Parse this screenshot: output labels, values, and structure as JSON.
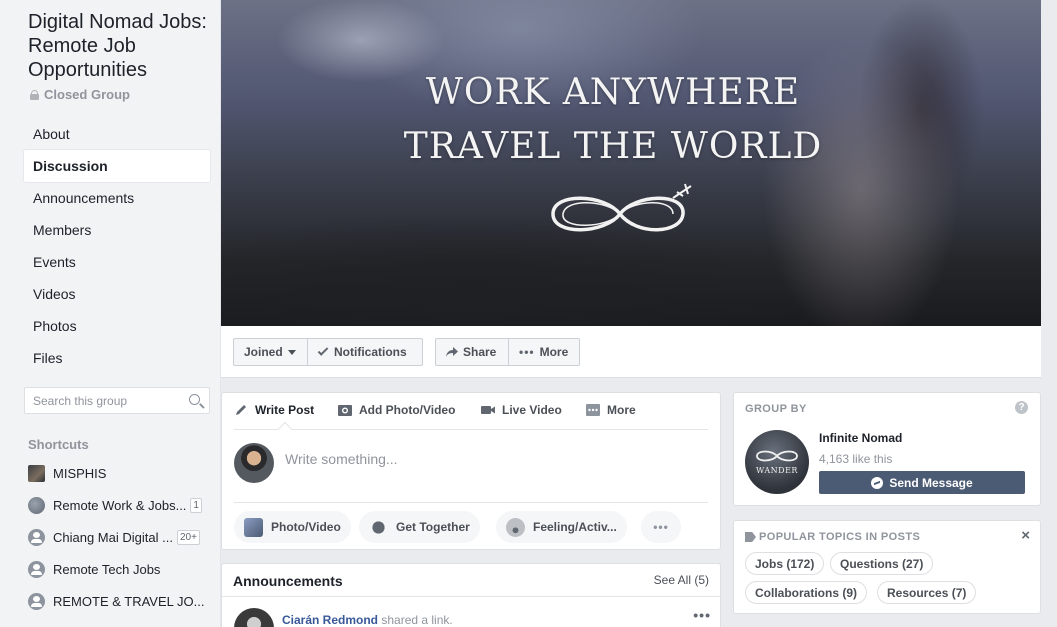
{
  "group": {
    "title": "Digital Nomad Jobs: Remote Job Opportunities",
    "privacy": "Closed Group"
  },
  "nav": [
    "About",
    "Discussion",
    "Announcements",
    "Members",
    "Events",
    "Videos",
    "Photos",
    "Files"
  ],
  "nav_active": "Discussion",
  "search": {
    "placeholder": "Search this group"
  },
  "shortcuts": {
    "heading": "Shortcuts",
    "items": [
      {
        "label": "MISPHIS",
        "badge": "",
        "icon": "image-thumbnail-icon"
      },
      {
        "label": "Remote Work & Jobs...",
        "badge": "1",
        "icon": "globe-icon"
      },
      {
        "label": "Chiang Mai Digital ...",
        "badge": "20+",
        "icon": "group-icon"
      },
      {
        "label": "Remote Tech Jobs",
        "badge": "",
        "icon": "group-icon"
      },
      {
        "label": "REMOTE & TRAVEL JO...",
        "badge": "",
        "icon": "group-icon"
      }
    ]
  },
  "cover": {
    "line1": "WORK ANYWHERE",
    "line2": "TRAVEL THE WORLD"
  },
  "actions": {
    "joined": "Joined",
    "notifications": "Notifications",
    "share": "Share",
    "more": "More"
  },
  "composer": {
    "tabs": [
      "Write Post",
      "Add Photo/Video",
      "Live Video",
      "More"
    ],
    "placeholder": "Write something...",
    "pills": [
      "Photo/Video",
      "Get Together",
      "Feeling/Activ..."
    ]
  },
  "announcements": {
    "title": "Announcements",
    "see_all": "See All (5)",
    "author": "Ciarán Redmond",
    "action": "shared a link."
  },
  "group_by": {
    "heading": "GROUP BY",
    "name": "Infinite Nomad",
    "likes": "4,163 like this",
    "button": "Send Message",
    "logo_text": "WANDER"
  },
  "topics": {
    "heading": "POPULAR TOPICS IN POSTS",
    "items": [
      "Jobs (172)",
      "Questions (27)",
      "Collaborations (9)",
      "Resources (7)"
    ]
  },
  "colors": {
    "brand_button": "#4b5b73",
    "link": "#385898",
    "page_bg": "#e9ebee"
  }
}
